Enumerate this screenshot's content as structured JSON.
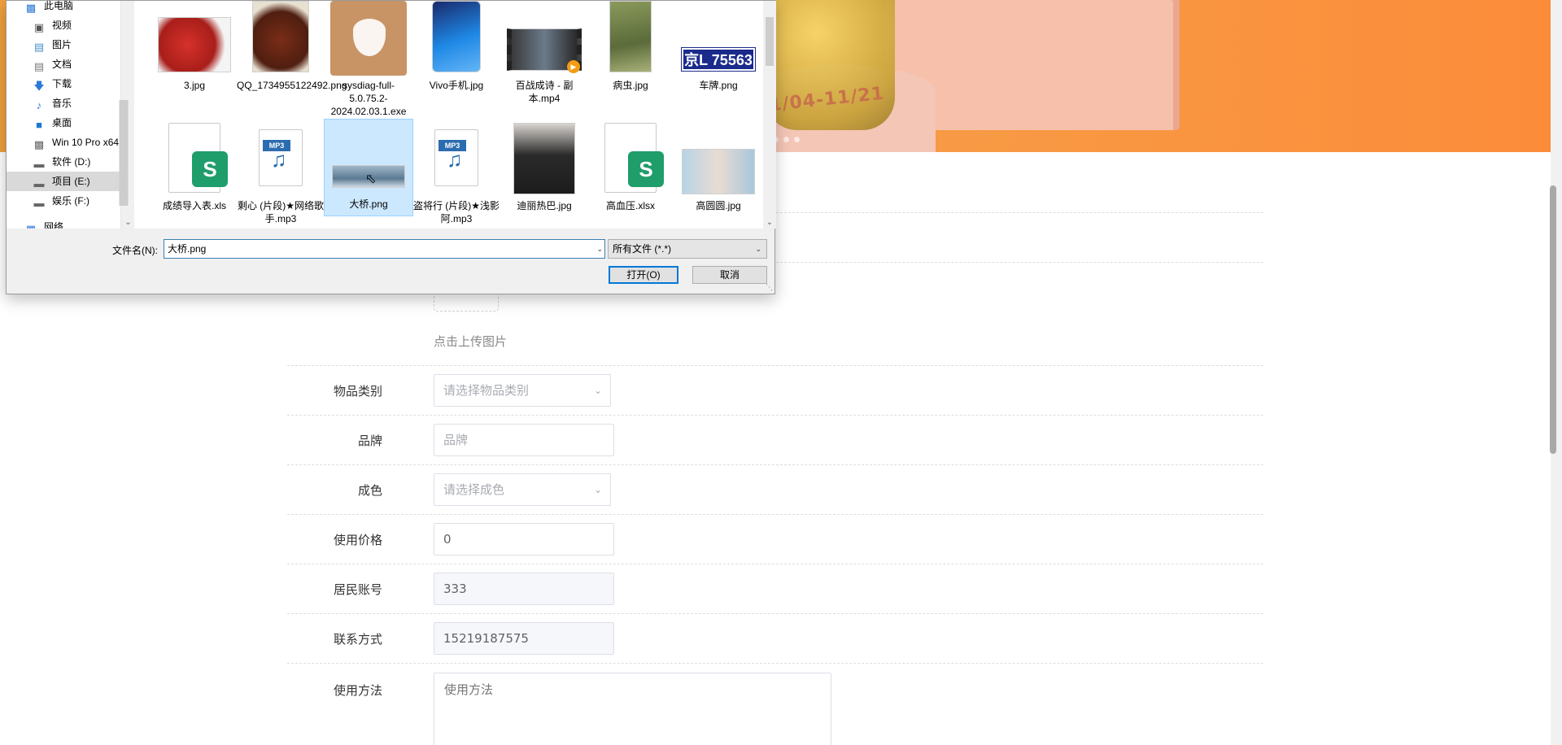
{
  "banner": {
    "date_text": "1/04-11/21"
  },
  "dialog": {
    "nav_items": [
      {
        "label": "此电脑",
        "icon": "computer-icon"
      },
      {
        "label": "视频",
        "icon": "video-folder-icon"
      },
      {
        "label": "图片",
        "icon": "pictures-folder-icon"
      },
      {
        "label": "文档",
        "icon": "documents-folder-icon"
      },
      {
        "label": "下载",
        "icon": "download-arrow-icon"
      },
      {
        "label": "音乐",
        "icon": "music-note-icon"
      },
      {
        "label": "桌面",
        "icon": "desktop-icon"
      },
      {
        "label": "Win 10 Pro x64",
        "icon": "drive-icon"
      },
      {
        "label": "软件 (D:)",
        "icon": "drive-icon"
      },
      {
        "label": "项目 (E:)",
        "icon": "drive-icon"
      },
      {
        "label": "娱乐 (F:)",
        "icon": "drive-icon"
      },
      {
        "label": "网络",
        "icon": "network-icon"
      }
    ],
    "files_row1": [
      {
        "name": "3.jpg"
      },
      {
        "name": "QQ_1734955122492.png"
      },
      {
        "name": "sysdiag-full-5.0.75.2-2024.02.03.1.exe"
      },
      {
        "name": "Vivo手机.jpg"
      },
      {
        "name": "百战成诗 - 副本.mp4"
      },
      {
        "name": "病虫.jpg"
      },
      {
        "name": "车牌.png",
        "plate_text": "京L 75563"
      }
    ],
    "files_row2": [
      {
        "name": "成绩导入表.xls"
      },
      {
        "name": "剩心 (片段)★网络歌手.mp3"
      },
      {
        "name": "大桥.png"
      },
      {
        "name": "盗将行 (片段)★浅影阿.mp3"
      },
      {
        "name": "迪丽热巴.jpg"
      },
      {
        "name": "高血压.xlsx"
      },
      {
        "name": "高圆圆.jpg"
      }
    ],
    "mp3_badge": "MP3",
    "xls_letter": "S",
    "filename_label": "文件名(N):",
    "filename_value": "大桥.png",
    "filetype_value": "所有文件 (*.*)",
    "open_label": "打开(O)",
    "cancel_label": "取消"
  },
  "form": {
    "upload_hint": "点击上传图片",
    "category_label": "物品类别",
    "category_placeholder": "请选择物品类别",
    "brand_label": "品牌",
    "brand_placeholder": "品牌",
    "condition_label": "成色",
    "condition_placeholder": "请选择成色",
    "price_label": "使用价格",
    "price_value": "0",
    "account_label": "居民账号",
    "account_value": "333",
    "contact_label": "联系方式",
    "contact_value": "15219187575",
    "usage_label": "使用方法",
    "usage_placeholder": "使用方法"
  }
}
